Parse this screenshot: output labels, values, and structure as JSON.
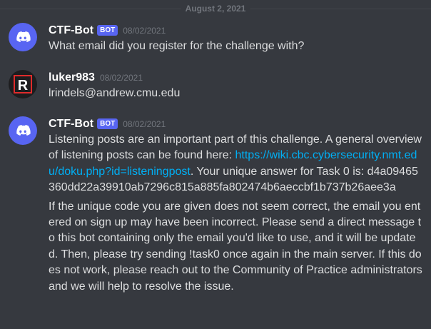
{
  "divider": {
    "date": "August 2, 2021"
  },
  "messages": [
    {
      "author": "CTF-Bot",
      "bot_tag": "BOT",
      "timestamp": "08/02/2021",
      "text": "What email did you register for the challenge with?"
    },
    {
      "author": "luker983",
      "timestamp": "08/02/2021",
      "text": "lrindels@andrew.cmu.edu"
    },
    {
      "author": "CTF-Bot",
      "bot_tag": "BOT",
      "timestamp": "08/02/2021",
      "para1_before": "Listening posts are an important part of this challenge. A general overview of listening posts can be found here: ",
      "para1_link": "https://wiki.cbc.cybersecurity.nmt.edu/doku.php?id=listeningpost",
      "para1_after": ". Your unique answer for Task 0 is: d4a09465360dd22a39910ab7296c815a885fa802474b6aeccbf1b737b26aee3a",
      "para2": "If the unique code you are given does not seem correct, the email you entered on sign up may have been incorrect. Please send a direct message to this bot containing only the email you'd like to use, and it will be updated. Then, please try sending !task0 once again in the main server. If this does not work, please reach out to the Community of Practice administrators and we will help to resolve the issue."
    }
  ],
  "icons": {
    "bot_avatar": "discord-logo-icon",
    "user_avatar": "r-logo-icon"
  },
  "colors": {
    "background": "#36393f",
    "blurple": "#5865f2",
    "link": "#00aff4",
    "text": "#dcddde",
    "muted": "#72767d"
  }
}
